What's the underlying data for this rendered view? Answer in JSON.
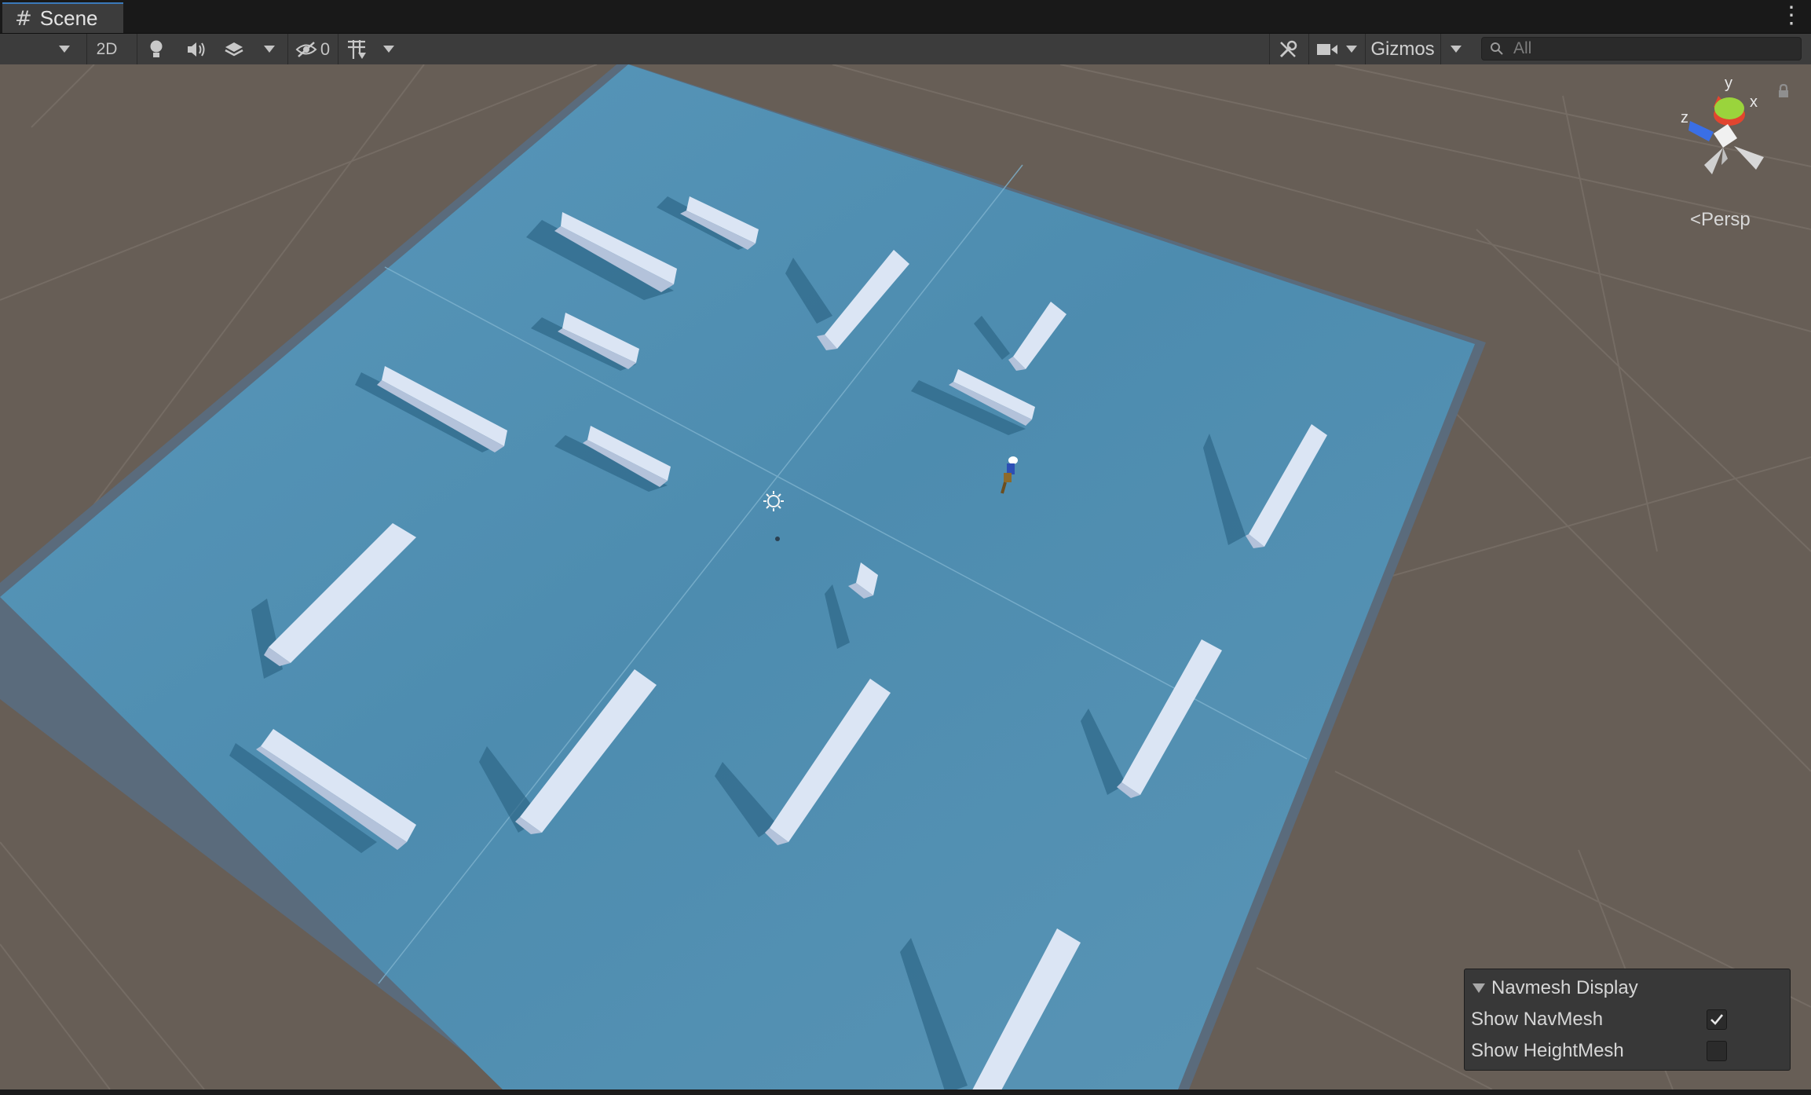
{
  "tab": {
    "icon": "grid-hash-icon",
    "label": "Scene"
  },
  "menu": {
    "icon": "more-vertical-icon"
  },
  "toolbar": {
    "draw_mode_icon": "chevron-down-icon",
    "mode_2d_label": "2D",
    "lighting_icon": "lightbulb-icon",
    "audio_icon": "speaker-icon",
    "effects_icon": "layers-stack-icon",
    "hidden_icon": "eye-slash-icon",
    "hidden_count": "0",
    "grid_icon": "grid-snap-icon",
    "tools_icon": "wrench-icon",
    "camera_icon": "camera-icon",
    "gizmos_label": "Gizmos",
    "search_icon": "search-icon",
    "search_placeholder": "All"
  },
  "scene_gizmo": {
    "axis_y": "y",
    "axis_x": "x",
    "axis_z": "z",
    "projection_label": "Persp",
    "lock_icon": "lock-icon",
    "colors": {
      "x": "#e2452f",
      "y": "#9ad43c",
      "z": "#3a6fe6"
    }
  },
  "navmesh_panel": {
    "title": "Navmesh Display",
    "show_navmesh_label": "Show NavMesh",
    "show_navmesh_checked": true,
    "show_heightmesh_label": "Show HeightMesh",
    "show_heightmesh_checked": false
  },
  "colors": {
    "accent": "#3a79bb",
    "ground": "#675e56",
    "navmesh": "#4e8eb0",
    "obstacle": "#d6e0ef"
  }
}
